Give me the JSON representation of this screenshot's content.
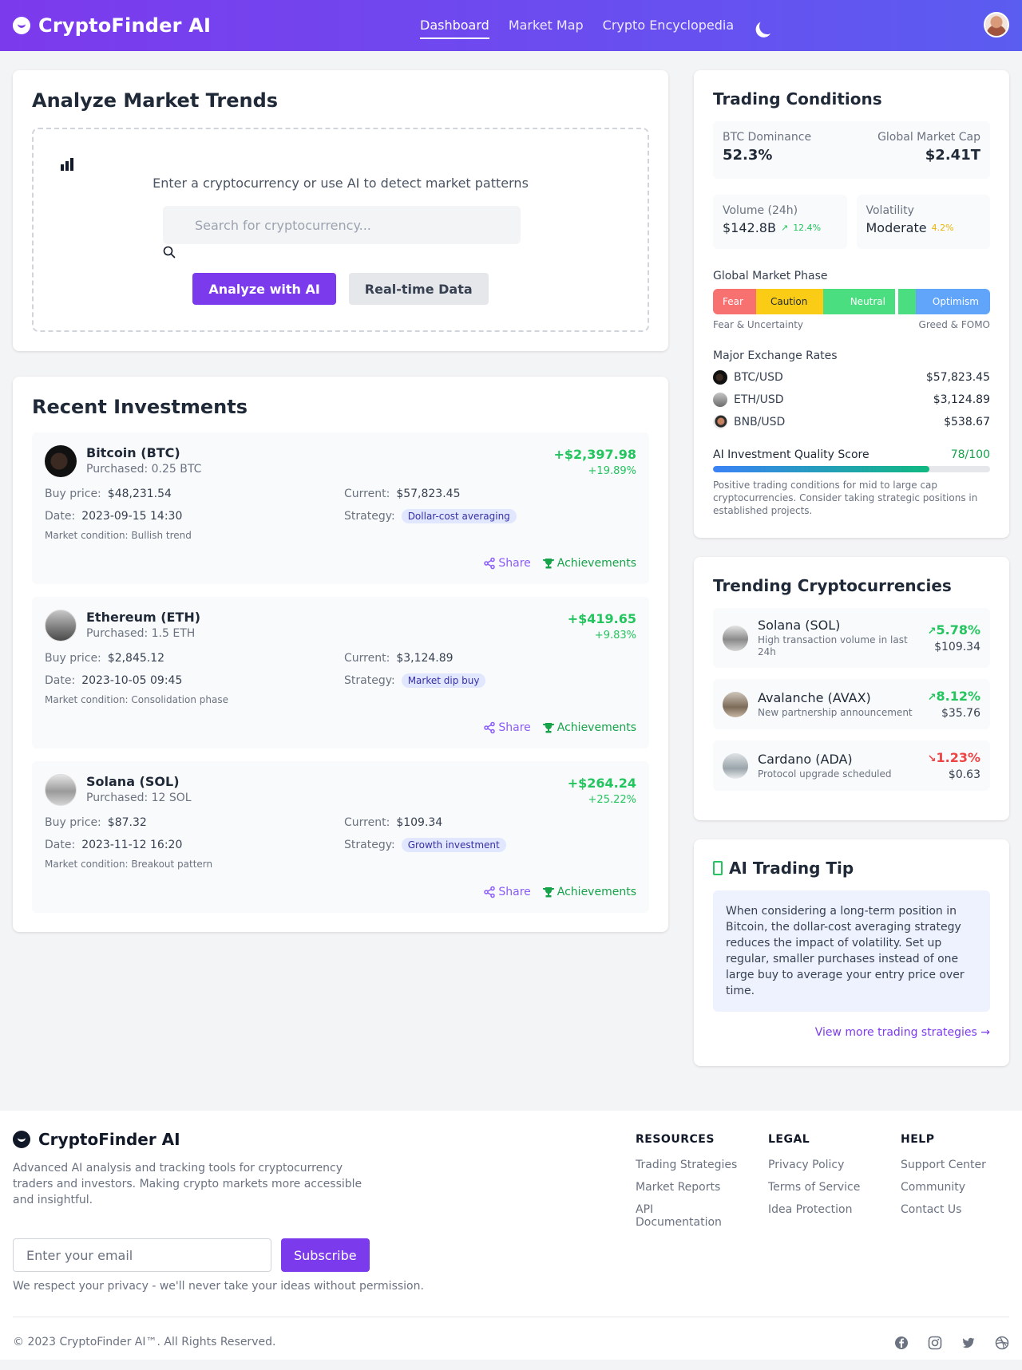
{
  "header": {
    "brand": "CryptoFinder AI",
    "nav": [
      {
        "label": "Dashboard",
        "active": true
      },
      {
        "label": "Market Map",
        "active": false
      },
      {
        "label": "Crypto Encyclopedia",
        "active": false
      }
    ],
    "theme_icon": "moon-icon",
    "avatar_icon": "user-avatar"
  },
  "analyze": {
    "title": "Analyze Market Trends",
    "prompt": "Enter a cryptocurrency or use AI to detect market patterns",
    "search_placeholder": "Search for cryptocurrency...",
    "search_value": "",
    "btn_ai": "Analyze with AI",
    "btn_realtime": "Real-time Data"
  },
  "investments": {
    "title": "Recent Investments",
    "labels": {
      "buy": "Buy price:",
      "current": "Current:",
      "date": "Date:",
      "strategy": "Strategy:",
      "share": "Share",
      "achievements": "Achievements"
    },
    "items": [
      {
        "name": "Bitcoin (BTC)",
        "purchased": "Purchased: 0.25 BTC",
        "gain": "+$2,397.98",
        "gain_pct": "+19.89%",
        "buy_price": "$48,231.54",
        "current": "$57,823.45",
        "date": "2023-09-15 14:30",
        "strategy": "Dollar-cost averaging",
        "condition": "Market condition: Bullish trend"
      },
      {
        "name": "Ethereum (ETH)",
        "purchased": "Purchased: 1.5 ETH",
        "gain": "+$419.65",
        "gain_pct": "+9.83%",
        "buy_price": "$2,845.12",
        "current": "$3,124.89",
        "date": "2023-10-05 09:45",
        "strategy": "Market dip buy",
        "condition": "Market condition: Consolidation phase"
      },
      {
        "name": "Solana (SOL)",
        "purchased": "Purchased: 12 SOL",
        "gain": "+$264.24",
        "gain_pct": "+25.22%",
        "buy_price": "$87.32",
        "current": "$109.34",
        "date": "2023-11-12 16:20",
        "strategy": "Growth investment",
        "condition": "Market condition: Breakout pattern"
      }
    ]
  },
  "trading": {
    "title": "Trading Conditions",
    "btc_dominance_label": "BTC Dominance",
    "btc_dominance": "52.3%",
    "market_cap_label": "Global Market Cap",
    "market_cap": "$2.41T",
    "volume_label": "Volume (24h)",
    "volume": "$142.8B",
    "volume_delta": "12.4%",
    "volatility_label": "Volatility",
    "volatility": "Moderate",
    "volatility_delta": "4.2%",
    "phase_title": "Global Market Phase",
    "phases": [
      "Fear",
      "Caution",
      "Neutral",
      "Optimism"
    ],
    "phase_left": "Fear & Uncertainty",
    "phase_right": "Greed & FOMO",
    "rates_title": "Major Exchange Rates",
    "rates": [
      {
        "pair": "BTC/USD",
        "value": "$57,823.45"
      },
      {
        "pair": "ETH/USD",
        "value": "$3,124.89"
      },
      {
        "pair": "BNB/USD",
        "value": "$538.67"
      }
    ],
    "score_label": "AI Investment Quality Score",
    "score_value": "78/100",
    "score": 0.78,
    "score_note": "Positive trading conditions for mid to large cap cryptocurrencies. Consider taking strategic positions in established projects."
  },
  "trending": {
    "title": "Trending Cryptocurrencies",
    "items": [
      {
        "name": "Solana (SOL)",
        "desc": "High transaction volume in last 24h",
        "pct": "5.78%",
        "dir": "up",
        "price": "$109.34"
      },
      {
        "name": "Avalanche (AVAX)",
        "desc": "New partnership announcement",
        "pct": "8.12%",
        "dir": "up",
        "price": "$35.76"
      },
      {
        "name": "Cardano (ADA)",
        "desc": "Protocol upgrade scheduled",
        "pct": "1.23%",
        "dir": "down",
        "price": "$0.63"
      }
    ]
  },
  "tip": {
    "title": "AI Trading Tip",
    "body": "When considering a long-term position in Bitcoin, the dollar-cost averaging strategy reduces the impact of volatility. Set up regular, smaller purchases instead of one large buy to average your entry price over time.",
    "link": "View more trading strategies →"
  },
  "footer": {
    "brand": "CryptoFinder AI",
    "desc": "Advanced AI analysis and tracking tools for cryptocurrency traders and investors. Making crypto markets more accessible and insightful.",
    "email_placeholder": "Enter your email",
    "subscribe": "Subscribe",
    "privacy": "We respect your privacy - we'll never take your ideas without permission.",
    "columns": [
      {
        "title": "RESOURCES",
        "links": [
          "Trading Strategies",
          "Market Reports",
          "API Documentation"
        ]
      },
      {
        "title": "LEGAL",
        "links": [
          "Privacy Policy",
          "Terms of Service",
          "Idea Protection"
        ]
      },
      {
        "title": "HELP",
        "links": [
          "Support Center",
          "Community",
          "Contact Us"
        ]
      }
    ],
    "copyright": "© 2023 CryptoFinder AI™. All Rights Reserved.",
    "social": [
      "facebook-icon",
      "instagram-icon",
      "twitter-icon",
      "dribbble-icon"
    ]
  },
  "colors": {
    "brand": "#7c3aed",
    "positive": "#22c55e",
    "negative": "#ef4444"
  }
}
